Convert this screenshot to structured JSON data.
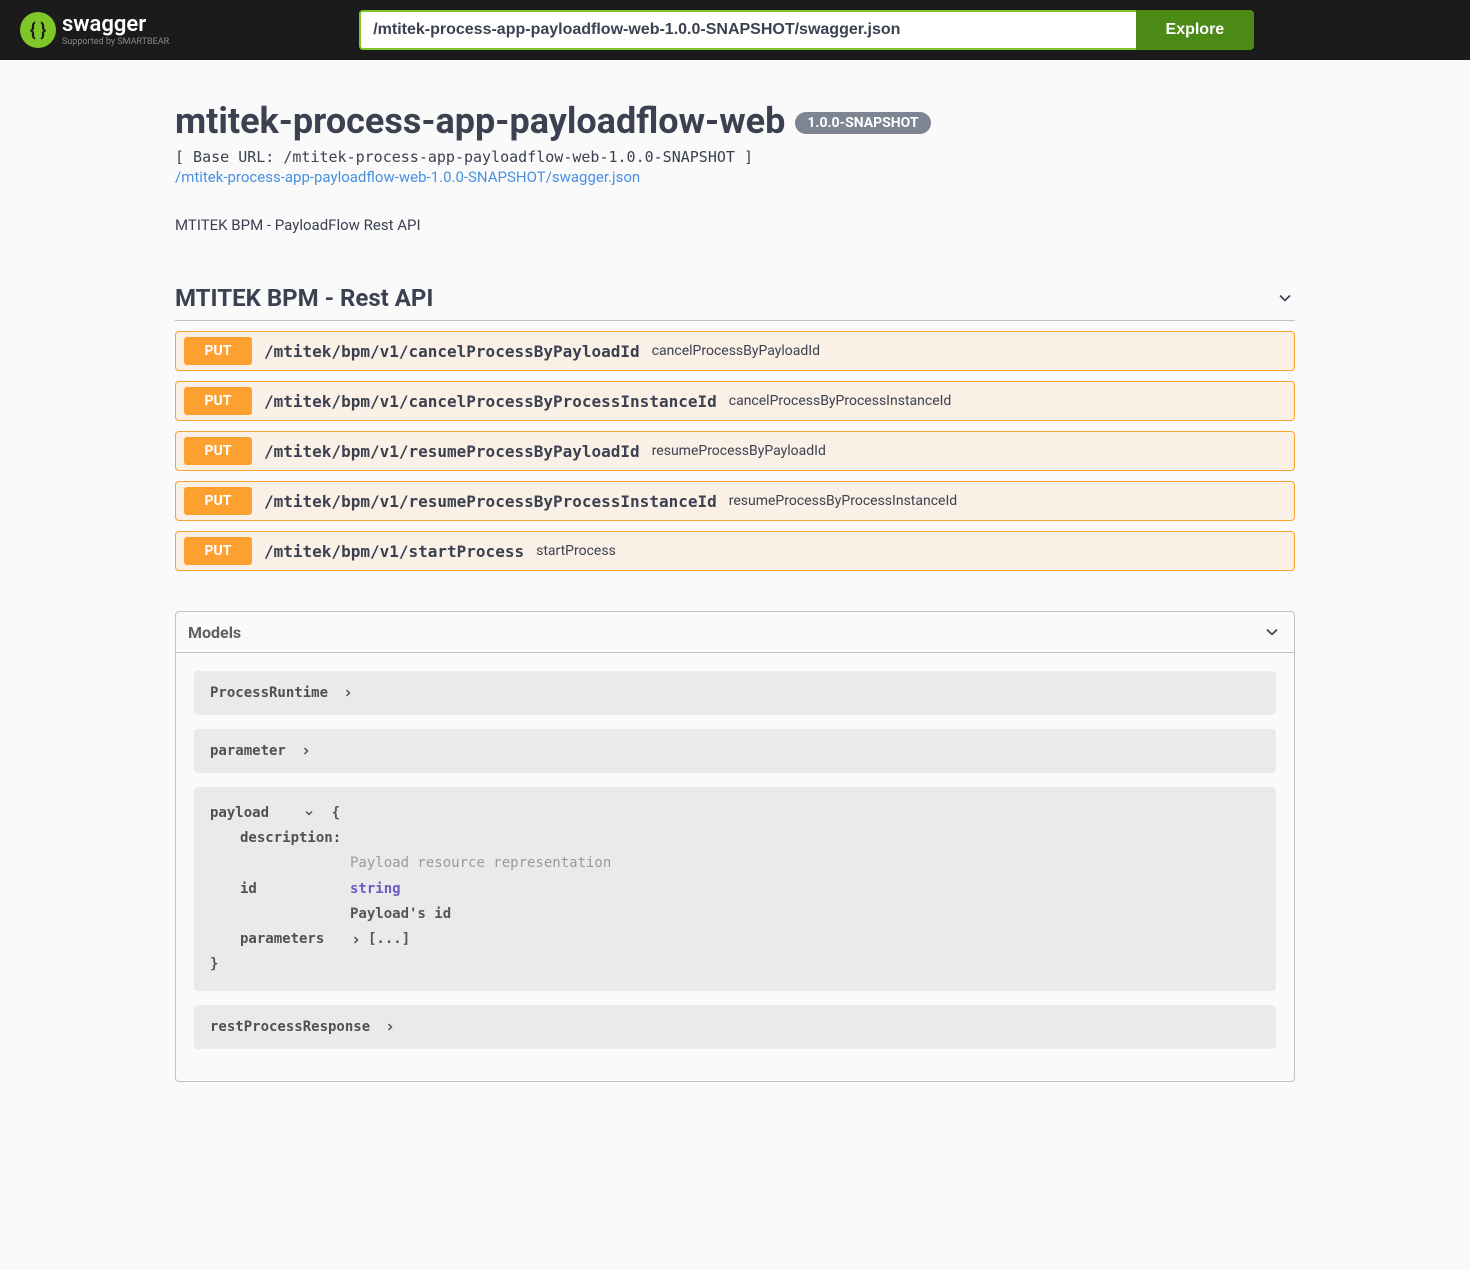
{
  "topbar": {
    "brand": "swagger",
    "supported_by": "Supported by SMARTBEAR",
    "search_value": "/mtitek-process-app-payloadflow-web-1.0.0-SNAPSHOT/swagger.json",
    "explore_label": "Explore"
  },
  "info": {
    "title": "mtitek-process-app-payloadflow-web",
    "version": "1.0.0-SNAPSHOT",
    "base_url_label": "[ Base URL: /mtitek-process-app-payloadflow-web-1.0.0-SNAPSHOT ]",
    "swagger_json_link": "/mtitek-process-app-payloadflow-web-1.0.0-SNAPSHOT/swagger.json",
    "description": "MTITEK BPM - PayloadFlow Rest API"
  },
  "tag": {
    "name": "MTITEK BPM - Rest API"
  },
  "operations": [
    {
      "method": "PUT",
      "path": "/mtitek/bpm/v1/cancelProcessByPayloadId",
      "summary": "cancelProcessByPayloadId"
    },
    {
      "method": "PUT",
      "path": "/mtitek/bpm/v1/cancelProcessByProcessInstanceId",
      "summary": "cancelProcessByProcessInstanceId"
    },
    {
      "method": "PUT",
      "path": "/mtitek/bpm/v1/resumeProcessByPayloadId",
      "summary": "resumeProcessByPayloadId"
    },
    {
      "method": "PUT",
      "path": "/mtitek/bpm/v1/resumeProcessByProcessInstanceId",
      "summary": "resumeProcessByProcessInstanceId"
    },
    {
      "method": "PUT",
      "path": "/mtitek/bpm/v1/startProcess",
      "summary": "startProcess"
    }
  ],
  "models": {
    "header": "Models",
    "items": [
      {
        "name": "ProcessRuntime",
        "expanded": false
      },
      {
        "name": "parameter",
        "expanded": false
      },
      {
        "name": "payload",
        "expanded": true,
        "open_brace": "{",
        "close_brace": "}",
        "desc_key": "description:",
        "desc_val": "Payload resource representation",
        "fields": [
          {
            "key": "id",
            "type": "string",
            "note": "Payload's id"
          },
          {
            "key": "parameters",
            "type_placeholder": "[...]"
          }
        ]
      },
      {
        "name": "restProcessResponse",
        "expanded": false
      }
    ]
  }
}
